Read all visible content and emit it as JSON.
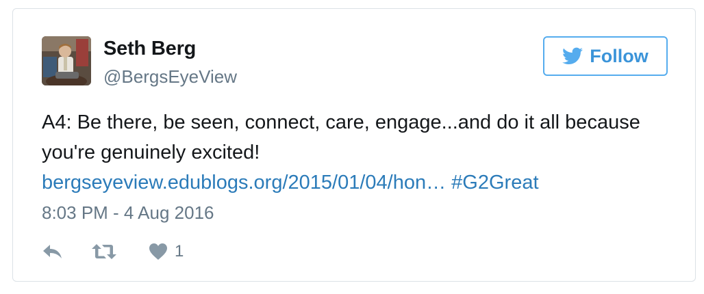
{
  "author": {
    "name": "Seth Berg",
    "handle": "@BergsEyeView"
  },
  "follow_button": {
    "label": "Follow",
    "icon": "twitter-bird-icon",
    "color": "#55acee"
  },
  "tweet": {
    "text_line": "A4: Be there, be seen, connect, care, engage...and do it all because you're genuinely excited!",
    "link": "bergseyeview.edublogs.org/2015/01/04/hon…",
    "hashtag": "#G2Great",
    "timestamp": "8:03 PM - 4 Aug 2016"
  },
  "actions": {
    "reply_icon": "reply-icon",
    "retweet_icon": "retweet-icon",
    "like_icon": "heart-icon",
    "like_count": "1"
  },
  "colors": {
    "text": "#14171a",
    "secondary": "#657786",
    "link": "#2b7bb9",
    "border": "#dbe1e6"
  }
}
